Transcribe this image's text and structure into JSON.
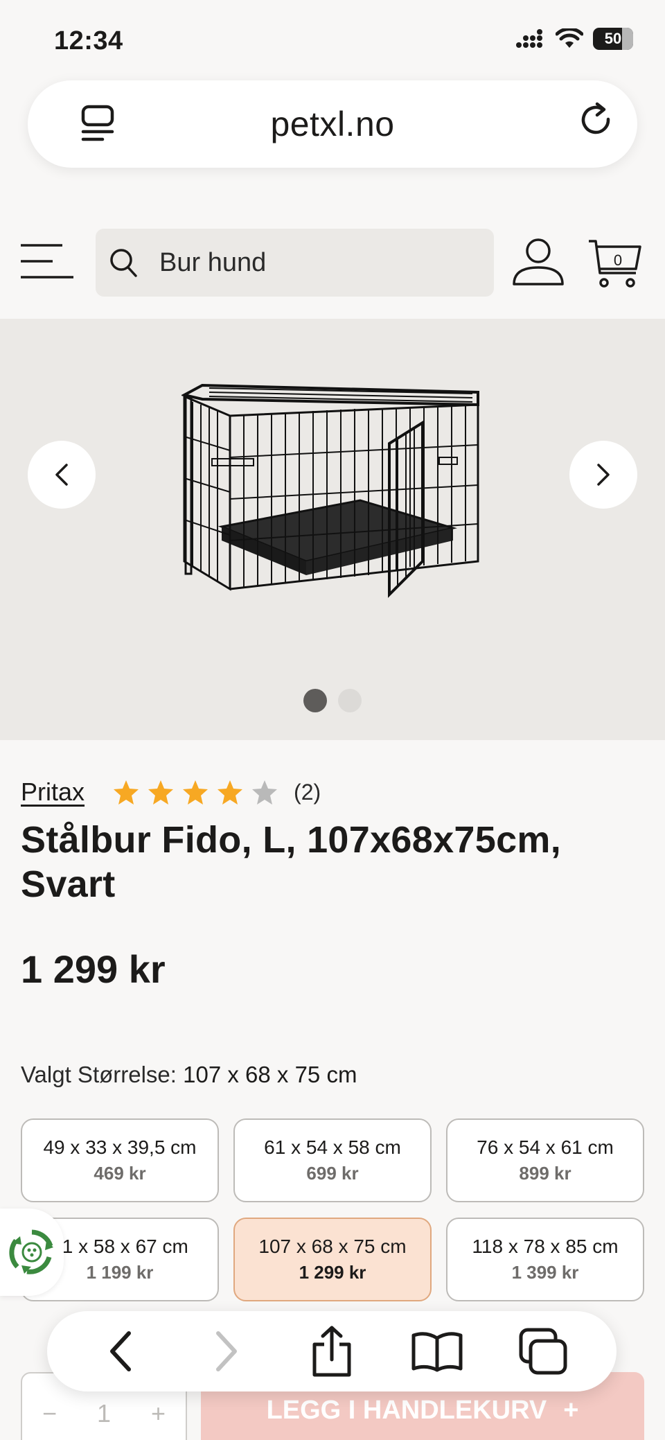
{
  "status": {
    "time": "12:34",
    "battery": "50"
  },
  "browser": {
    "url": "petxl.no"
  },
  "header": {
    "search_text": "Bur hund",
    "cart_count": "0"
  },
  "product": {
    "brand": "Pritax",
    "rating": 4,
    "rating_max": 5,
    "review_count": "(2)",
    "title": "Stålbur Fido, L, 107x68x75cm, Svart",
    "price": "1 299 kr",
    "selected_size_label": "Valgt Størrelse:",
    "selected_size_value": "107 x 68 x 75 cm",
    "sizes": [
      {
        "dim": "49 x 33 x 39,5 cm",
        "price": "469 kr"
      },
      {
        "dim": "61 x 54 x 58 cm",
        "price": "699 kr"
      },
      {
        "dim": "76 x 54 x 61 cm",
        "price": "899 kr"
      },
      {
        "dim": "91 x 58 x 67 cm",
        "price": "1 199 kr"
      },
      {
        "dim": "107 x 68 x 75 cm",
        "price": "1 299 kr"
      },
      {
        "dim": "118 x 78 x 85 cm",
        "price": "1 399 kr"
      }
    ]
  },
  "cart_bar": {
    "quantity": "1",
    "minus": "−",
    "plus": "+",
    "add_label": "LEGG I HANDLEKURV",
    "add_plus": "+"
  },
  "colors": {
    "accent_star": "#f7a823",
    "selected_bg": "#fbe2d2",
    "selected_border": "#e0a87f"
  }
}
